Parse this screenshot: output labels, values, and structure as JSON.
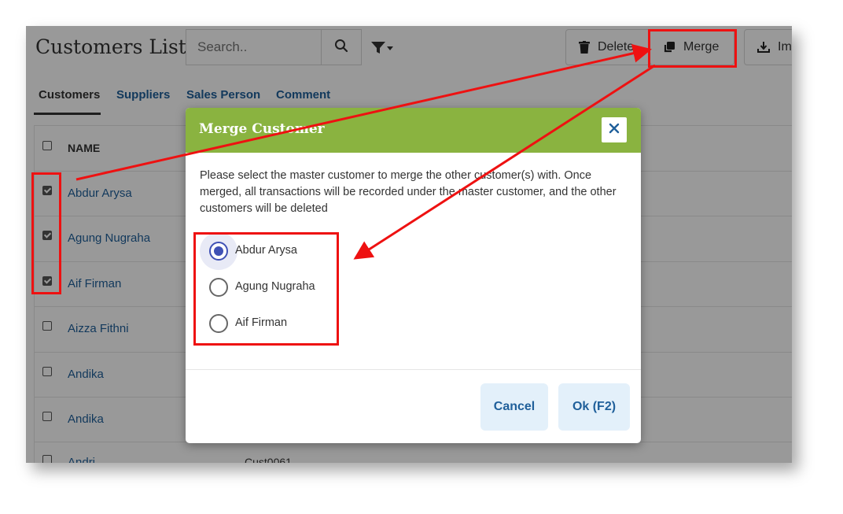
{
  "page": {
    "title": "Customers List",
    "search_placeholder": "Search..",
    "toolbar": {
      "delete_label": "Delete",
      "merge_label": "Merge",
      "import_label": "Import"
    }
  },
  "tabs": [
    {
      "label": "Customers",
      "active": true
    },
    {
      "label": "Suppliers"
    },
    {
      "label": "Sales Person"
    },
    {
      "label": "Comment"
    }
  ],
  "table": {
    "header": {
      "name": "NAME"
    },
    "rows": [
      {
        "name": "Abdur Arysa",
        "checked": true
      },
      {
        "name": "Agung Nugraha",
        "checked": true
      },
      {
        "name": "Aif Firman",
        "checked": true
      },
      {
        "name": "Aizza Fithni",
        "checked": false
      },
      {
        "name": "Andika",
        "checked": false
      },
      {
        "name": "Andika",
        "checked": false
      },
      {
        "name": "Andri",
        "code": "Cust0061",
        "checked": false
      }
    ]
  },
  "modal": {
    "title": "Merge Customer",
    "message": "Please select the master customer to merge the other customer(s) with. Once merged, all transactions will be recorded under the master customer, and the other customers will be deleted",
    "options": [
      {
        "label": "Abdur Arysa",
        "selected": true
      },
      {
        "label": "Agung Nugraha",
        "selected": false
      },
      {
        "label": "Aif Firman",
        "selected": false
      }
    ],
    "cancel_label": "Cancel",
    "ok_label": "Ok (F2)"
  },
  "colors": {
    "modal_header": "#8ab340",
    "link": "#1f5f9a",
    "annotation": "#ee1111",
    "radio_selected": "#3f51b5"
  },
  "icons": [
    "search-icon",
    "filter-icon",
    "trash-icon",
    "merge-icon",
    "import-icon",
    "close-icon"
  ]
}
